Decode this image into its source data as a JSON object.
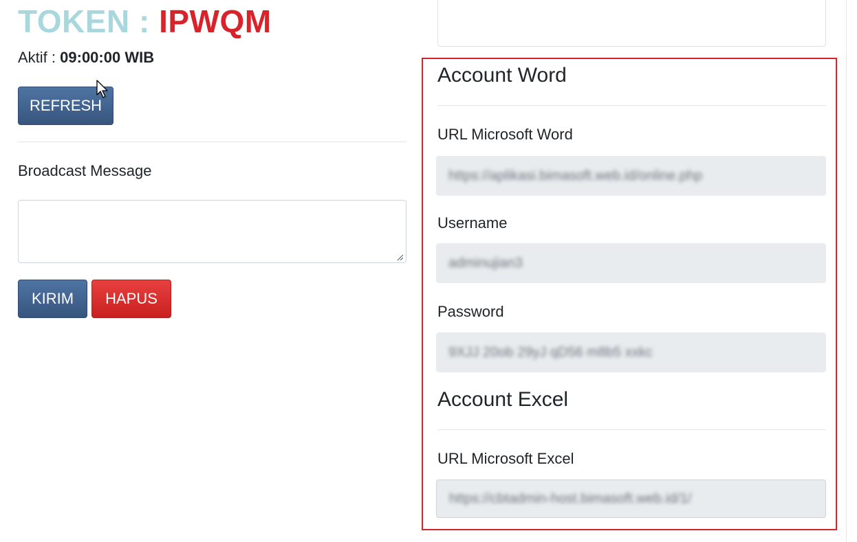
{
  "token": {
    "label": "TOKEN :",
    "value": "IPWQM",
    "label_color": "#a8d8dd",
    "value_color": "#d8232a"
  },
  "aktif": {
    "label": "Aktif :",
    "time": "09:00:00 WIB"
  },
  "buttons": {
    "refresh": "REFRESH",
    "kirim": "KIRIM",
    "hapus": "HAPUS"
  },
  "broadcast": {
    "label": "Broadcast Message",
    "value": ""
  },
  "account_word": {
    "title": "Account Word",
    "url_label": "URL Microsoft Word",
    "url_value": "https://aplikasi.bimasoft.web.id/online.php",
    "username_label": "Username",
    "username_value": "adminujian3",
    "password_label": "Password",
    "password_value": "9XJJ 20ob 29yJ qD56 m8b5 xxkc"
  },
  "account_excel": {
    "title": "Account Excel",
    "url_label": "URL Microsoft Excel",
    "url_value": "https://cbtadmin-host.bimasoft.web.id/1/"
  },
  "colors": {
    "primary": "#3f6391",
    "danger": "#d8232a",
    "highlight": "#d3252b"
  },
  "icons": {
    "cursor": "mouse-pointer-icon",
    "resize": "resize-grip-icon"
  }
}
